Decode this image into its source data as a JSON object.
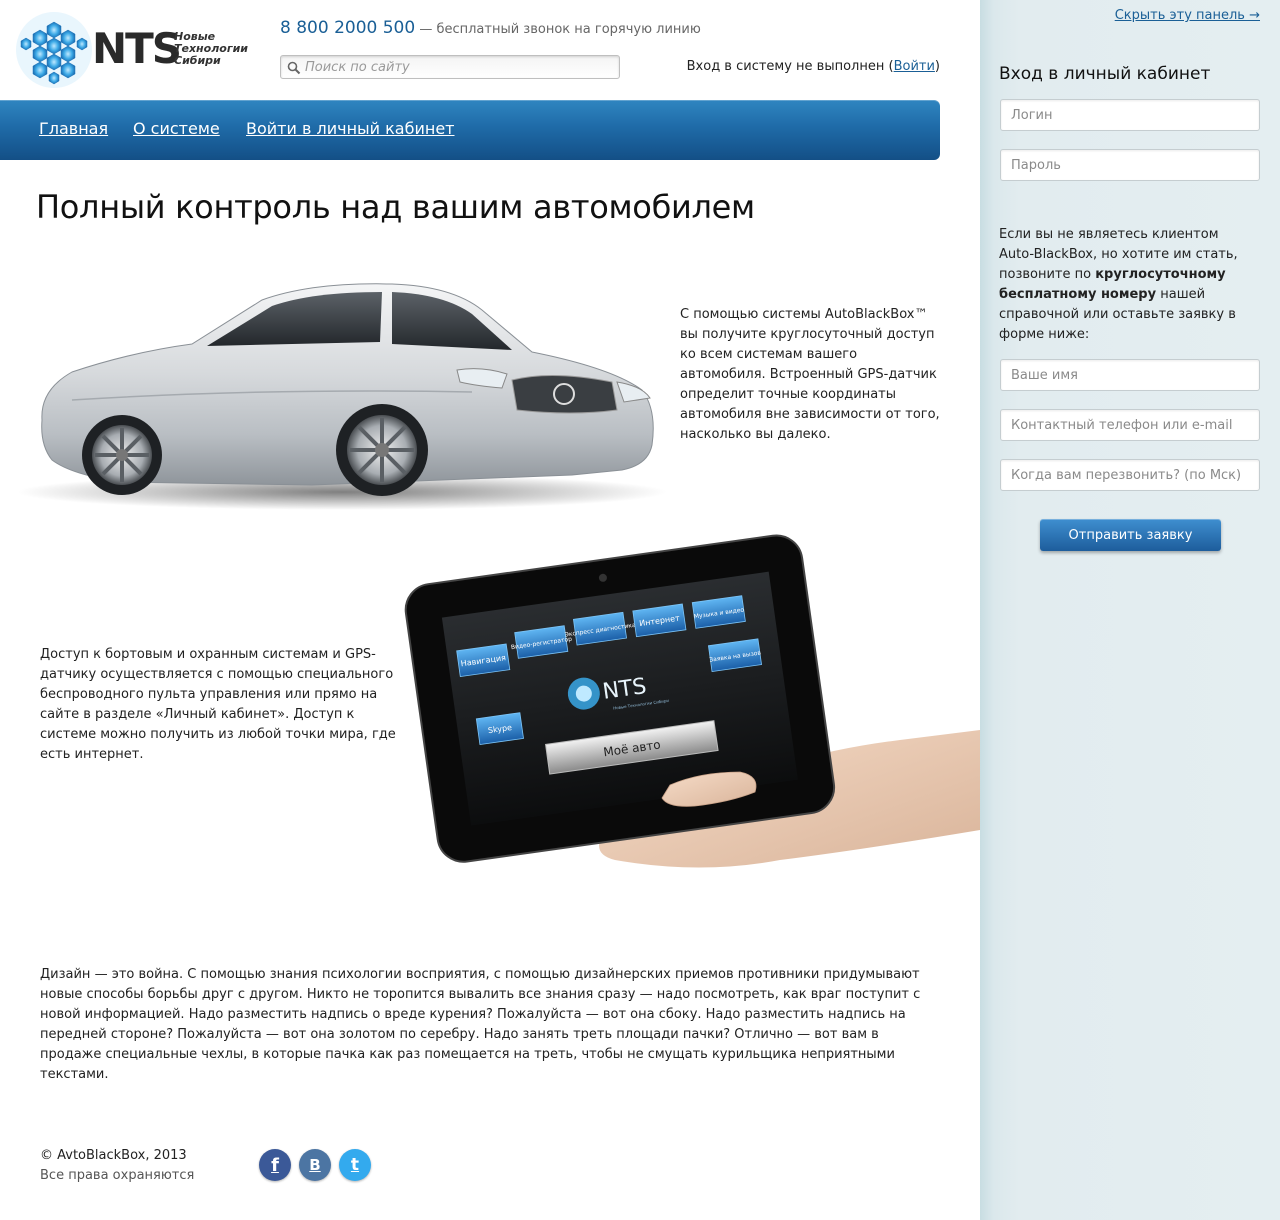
{
  "header": {
    "logo": {
      "brand": "NTS",
      "tagline": [
        "Новые",
        "Технологии",
        "Сибири"
      ]
    },
    "hotline": {
      "number": "8 800 2000 500",
      "text": " — бесплатный звонок на горячую линию"
    },
    "search": {
      "placeholder": "Поиск по сайту",
      "value": ""
    },
    "login_status": {
      "text_before": "Вход в систему не выполнен (",
      "link": "Войти",
      "text_after": ")"
    }
  },
  "nav": {
    "items": [
      {
        "label": "Главная"
      },
      {
        "label": "О системе"
      },
      {
        "label": "Войти в личный кабинет"
      }
    ]
  },
  "main": {
    "title": "Полный контроль над вашим автомобилем",
    "para1": "С помощью системы AutoBlackBox™ вы получите круглосуточный доступ ко всем системам вашего автомобиля. Встроенный GPS-датчик определит точные координаты автомобиля вне зависимости от того, насколько вы далеко.",
    "para2": "Доступ к бортовым и охранным системам и GPS-датчику осуществляется с помощью специального беспроводного пульта управления или прямо на сайте в разделе «Личный кабинет». Доступ к системе можно получить из любой точки мира, где есть интернет.",
    "para3": "Дизайн — это война. С помощью знания психологии восприятия, с помощью дизайнерских приемов противники придумывают новые способы борьбы друг с другом. Никто не торопится вывалить все знания сразу — надо посмотреть, как враг поступит с новой информацией. Надо разместить надпись о вреде курения? Пожалуйста — вот она сбоку. Надо разместить надпись на передней стороне? Пожалуйста — вот она золотом по серебру. Надо занять треть площади пачки? Отлично — вот вам в продаже специальные чехлы, в которые пачка как раз помещается на треть, чтобы не смущать курильщика неприятными текстами.",
    "tablet": {
      "buttons": [
        "Навигация",
        "Видео-регистратор",
        "Экспресс диагностика",
        "Интернет",
        "Музыка и видео",
        "Заявка на вызов",
        "Skype"
      ],
      "logo": "NTS",
      "logo_sub": "Новые Технологии Сибири",
      "main_button": "Моё авто"
    }
  },
  "footer": {
    "copyright": "© AvtoBlackBox, 2013",
    "rights": "Все права охраняются",
    "social": [
      {
        "icon": "facebook-icon",
        "glyph": "f",
        "color": "#3b5998"
      },
      {
        "icon": "vk-icon",
        "glyph": "B",
        "color": "#4c75a3"
      },
      {
        "icon": "twitter-icon",
        "glyph": "t",
        "color": "#33aaee"
      }
    ]
  },
  "side": {
    "hide_link": "Скрыть эту панель →",
    "title": "Вход в личный кабинет",
    "login_placeholder": "Логин",
    "password_placeholder": "Пароль",
    "info_before": "Если вы не являетесь клиентом Auto-BlackBox, но хотите им стать, позвоните по ",
    "info_bold": "круглосуточному бесплатному номеру",
    "info_after": " нашей справочной или оставьте заявку в форме ниже:",
    "name_placeholder": "Ваше имя",
    "contact_placeholder": "Контактный телефон или e-mail",
    "callback_placeholder": "Когда вам перезвонить? (по Мск)",
    "submit_label": "Отправить заявку"
  },
  "colors": {
    "accent": "#1a5f96",
    "nav_top": "#2f85c0",
    "nav_bottom": "#134f86",
    "panel_bg": "#e2ecef"
  }
}
